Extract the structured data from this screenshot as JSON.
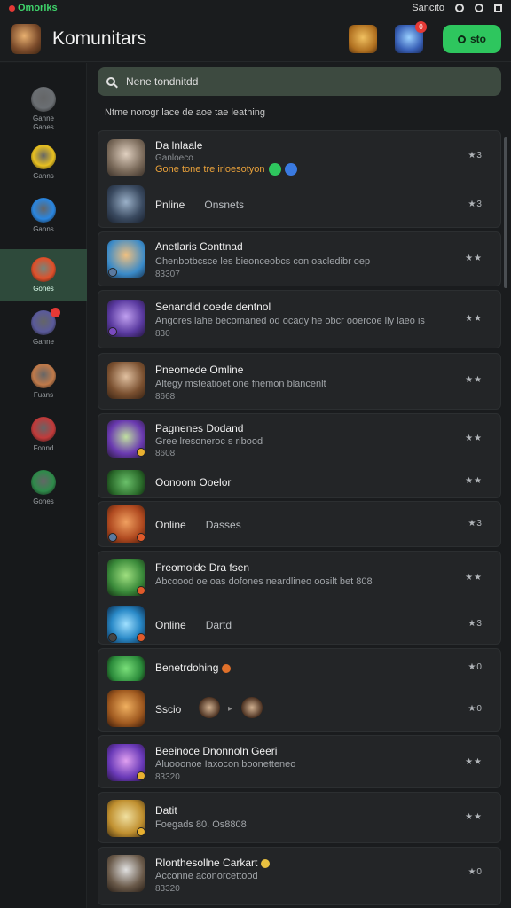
{
  "status": {
    "brand": "Omorlks",
    "right_text": "Sancito"
  },
  "header": {
    "title": "Komunitars",
    "go_label": "sto",
    "notif_count": "0"
  },
  "search": {
    "placeholder": "Nene tondnitdd"
  },
  "subline": "Ntme norogr lace de aoe tae leathing",
  "sidebar": [
    {
      "label": "Ganne\nGanes",
      "icon": "disc-icon",
      "color": "#6b6f73"
    },
    {
      "label": "Ganns",
      "icon": "lightning-icon",
      "color": "#e8c020"
    },
    {
      "label": "Ganns",
      "icon": "swirl-icon",
      "color": "#2a86e0"
    },
    {
      "label": "Gones",
      "icon": "fire-icon",
      "color": "#e0502a",
      "active": true
    },
    {
      "label": "Ganne",
      "icon": "character-icon",
      "color": "#5a5a9a",
      "badge": true
    },
    {
      "label": "Fuans",
      "icon": "hero-icon",
      "color": "#c07a4a"
    },
    {
      "label": "Fonnd",
      "icon": "card-icon",
      "color": "#c23a3a"
    },
    {
      "label": "Gones",
      "icon": "clover-icon",
      "color": "#2e8a4a"
    }
  ],
  "items": [
    {
      "title": "Da lnlaale",
      "sub": "Ganloeco",
      "sub2": "Gone tone tre irloesotyon",
      "stat1": "Pnline",
      "stat2": "Onsnets",
      "stars1": "★3",
      "stars2": "★3"
    },
    {
      "title": "Anetlaris Conttnad",
      "sub": "Chenbotbcsce les bieonceobcs con oacledibr oep",
      "num": "83307",
      "stars": "★★"
    },
    {
      "title": "Senandid ooede dentnol",
      "sub": "Angores lahe becomaned od ocady he obcr ooercoe lly laeo is",
      "num": "830",
      "stars": "★★"
    },
    {
      "title": "Pneomede Omline",
      "sub": "Altegy msteatioet one fnemon blancenlt",
      "num": "8668",
      "stars": "★★"
    },
    {
      "title": "Pagnenes Dodand",
      "sub": "Gree lresoneroc s ribood",
      "num": "8608",
      "stars": "★★",
      "extra_title": "Oonoom Ooelor",
      "extra_stars": "★★"
    },
    {
      "title": "Online",
      "sub": "Dasses",
      "stars": "★3"
    },
    {
      "title": "Freomoide Dra fsen",
      "sub": "Abcoood oe oas dofones neardlineo oosilt bet 808",
      "stars": "★★",
      "stat1": "Online",
      "stat2": "Dartd",
      "stars2": "★3"
    },
    {
      "title": "Benetrdohing",
      "stars": "★0",
      "stat1": "Sscio",
      "stars2": "★0"
    },
    {
      "title": "Beeinoce Dnonnoln Geeri",
      "sub": "Aluooonoe Iaxocon boonetteneo",
      "num": "83320",
      "stars": "★★"
    },
    {
      "title": "Datit",
      "sub": "Foegads 80. Os8808",
      "stars": "★★"
    },
    {
      "title": "Rlonthesollne Carkart",
      "sub": "Acconne aconorcettood",
      "num": "83320",
      "stars": "★0"
    }
  ]
}
